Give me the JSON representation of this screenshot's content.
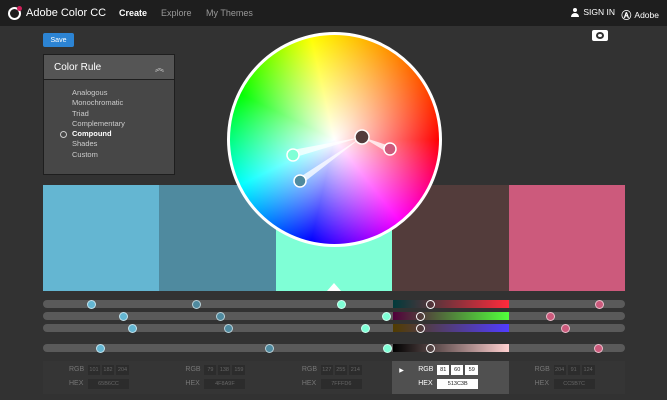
{
  "header": {
    "app_title": "Adobe Color CC",
    "nav": [
      "Create",
      "Explore",
      "My Themes"
    ],
    "sign_in": "SIGN IN",
    "adobe": "Adobe"
  },
  "toolbar": {
    "save_label": "Save"
  },
  "color_rule": {
    "title": "Color Rule",
    "options": [
      "Analogous",
      "Monochromatic",
      "Triad",
      "Complementary",
      "Compound",
      "Shades",
      "Custom"
    ],
    "selected": "Compound"
  },
  "swatches": [
    {
      "color": "#64b6d2"
    },
    {
      "color": "#4f8a9f"
    },
    {
      "color": "#7fffd6"
    },
    {
      "color": "#533c3b"
    },
    {
      "color": "#cc5a7c"
    }
  ],
  "values": [
    {
      "rgb_label": "RGB",
      "hex_label": "HEX",
      "rgb": [
        "101",
        "182",
        "204"
      ],
      "hex": "65B6CC"
    },
    {
      "rgb_label": "RGB",
      "hex_label": "HEX",
      "rgb": [
        "79",
        "138",
        "159"
      ],
      "hex": "4F8A9F"
    },
    {
      "rgb_label": "RGB",
      "hex_label": "HEX",
      "rgb": [
        "127",
        "255",
        "214"
      ],
      "hex": "7FFFD6"
    },
    {
      "rgb_label": "RGB",
      "hex_label": "HEX",
      "rgb": [
        "81",
        "60",
        "59"
      ],
      "hex": "513C3B"
    },
    {
      "rgb_label": "RGB",
      "hex_label": "HEX",
      "rgb": [
        "204",
        "91",
        "124"
      ],
      "hex": "CC5B7C"
    }
  ],
  "colors": {
    "save_button": "#2c84d4",
    "slider_red": "#ff2a2a",
    "slider_green": "#3cff3c",
    "slider_blue": "#4a4aff"
  }
}
